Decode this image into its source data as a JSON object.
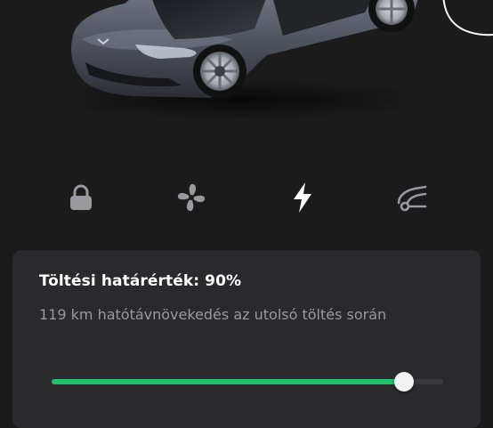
{
  "controls": [
    {
      "icon": "lock-icon",
      "active": false
    },
    {
      "icon": "fan-icon",
      "active": false
    },
    {
      "icon": "charge-bolt-icon",
      "active": true
    },
    {
      "icon": "trunk-icon",
      "active": false
    }
  ],
  "charge": {
    "title": "Töltési határérték: 90%",
    "subtitle": "119 km hatótávnövekedés az utolsó töltés során",
    "limit_percent": 90
  },
  "colors": {
    "background": "#1b1b1c",
    "card": "#2a2a2c",
    "accent_green": "#21c06b",
    "icon_inactive": "#9a9a9e",
    "icon_active": "#ffffff"
  }
}
